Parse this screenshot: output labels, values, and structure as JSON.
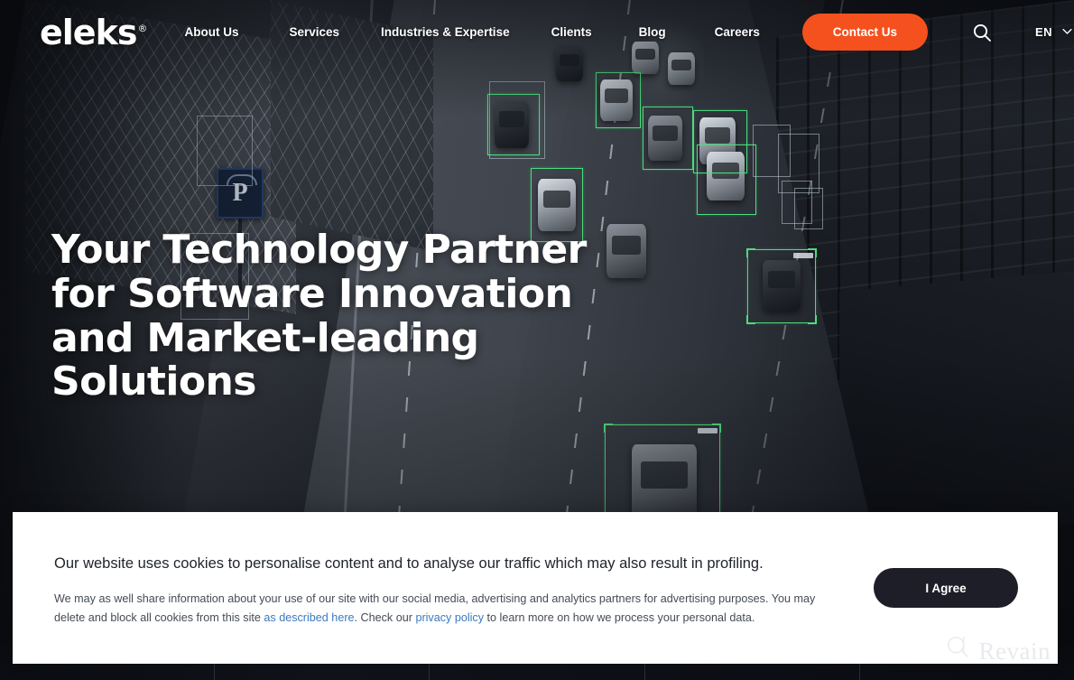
{
  "header": {
    "logo_text": "eleks",
    "logo_trademark": "®",
    "nav": [
      {
        "label": "About Us"
      },
      {
        "label": "Services"
      },
      {
        "label": "Industries & Expertise"
      },
      {
        "label": "Clients"
      },
      {
        "label": "Blog"
      },
      {
        "label": "Careers"
      }
    ],
    "contact_label": "Contact Us",
    "search_icon": "search-icon",
    "language": {
      "code": "EN",
      "chevron_icon": "chevron-down-icon"
    },
    "accent_color": "#f4511e"
  },
  "hero": {
    "headline": "Your Technology Partner for Software Innovation and Market-leading Solutions",
    "detection_box_color": "#4ddc7d",
    "sign_label": "P"
  },
  "cookie": {
    "title": "Our website uses cookies to personalise content and to analyse our traffic which may also result in profiling.",
    "body_1": "We may as well share information about your use of our site with our social media, advertising and analytics partners for advertising purposes. You may delete and block all cookies from this site ",
    "link_described": "as described here",
    "body_2": ". Check our ",
    "link_privacy": "privacy policy",
    "body_3": " to learn more on how we process your personal data.",
    "agree_label": "I Agree",
    "link_color": "#3a7ac0",
    "button_color": "#1e1e28"
  },
  "watermark": {
    "text": "Revain",
    "icon": "revain-logo-icon"
  }
}
